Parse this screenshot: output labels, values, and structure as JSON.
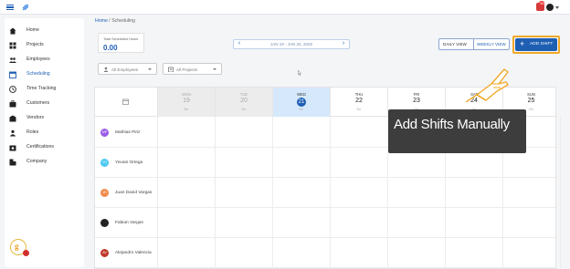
{
  "header": {
    "notification_count": "35",
    "icons": [
      "menu-icon",
      "app-logo",
      "bell-icon",
      "user-avatar",
      "chevron-down-icon"
    ]
  },
  "sidebar": {
    "items": [
      {
        "label": "Home",
        "icon": "home-icon"
      },
      {
        "label": "Projects",
        "icon": "projects-icon"
      },
      {
        "label": "Employees",
        "icon": "employees-icon"
      },
      {
        "label": "Scheduling",
        "icon": "calendar-icon",
        "active": true
      },
      {
        "label": "Time Tracking",
        "icon": "clock-icon"
      },
      {
        "label": "Customers",
        "icon": "briefcase-icon"
      },
      {
        "label": "Vendors",
        "icon": "vendors-icon"
      },
      {
        "label": "Roles",
        "icon": "roles-icon"
      },
      {
        "label": "Certifications",
        "icon": "certifications-icon"
      },
      {
        "label": "Company",
        "icon": "company-icon"
      }
    ],
    "support_icon": "support-chat-icon"
  },
  "breadcrumb": {
    "home": "Home",
    "separator": "/",
    "current": "Scheduling"
  },
  "summary": {
    "label": "Total Scheduled Hours",
    "value": "0.00"
  },
  "date_nav": {
    "range": "JAN 19 - JAN 25, 2026",
    "prev": "‹",
    "next": "›"
  },
  "view_toggle": {
    "daily": "DAILY VIEW",
    "weekly": "WEEKLY VIEW",
    "active": "weekly"
  },
  "add_shift": {
    "label": "ADD SHIFT",
    "plus": "+"
  },
  "filters": {
    "employees": "All Employees",
    "projects": "All Projects"
  },
  "calendar": {
    "days": [
      {
        "name": "MON",
        "num": "19",
        "hours": "0hr",
        "state": "past"
      },
      {
        "name": "TUE",
        "num": "20",
        "hours": "0hr",
        "state": "past"
      },
      {
        "name": "WED",
        "num": "21",
        "hours": "0hr",
        "state": "today"
      },
      {
        "name": "THU",
        "num": "22",
        "hours": "0hr",
        "state": "future"
      },
      {
        "name": "FRI",
        "num": "23",
        "hours": "0hr",
        "state": "future"
      },
      {
        "name": "SAT",
        "num": "24",
        "hours": "0hr",
        "state": "future"
      },
      {
        "name": "SUN",
        "num": "25",
        "hours": "0hr",
        "state": "future"
      }
    ],
    "employees": [
      {
        "name": "Mathias Piriz",
        "initials": "MP",
        "color": "#9b5de5"
      },
      {
        "name": "Yovani Ortega",
        "initials": "YO",
        "color": "#4cc9f0"
      },
      {
        "name": "Juan David Vargas",
        "initials": "JD",
        "color": "#f08a4b"
      },
      {
        "name": "Fabian Vargas",
        "initials": "",
        "color": "#222222"
      },
      {
        "name": "Alejandro Valencia",
        "initials": "AV",
        "color": "#c0392b"
      }
    ]
  },
  "tooltip": {
    "text": "Add Shifts Manually"
  },
  "colors": {
    "primary": "#1e5fb4",
    "highlight": "#f0a82a",
    "tooltip_bg": "#3d3d3d"
  }
}
